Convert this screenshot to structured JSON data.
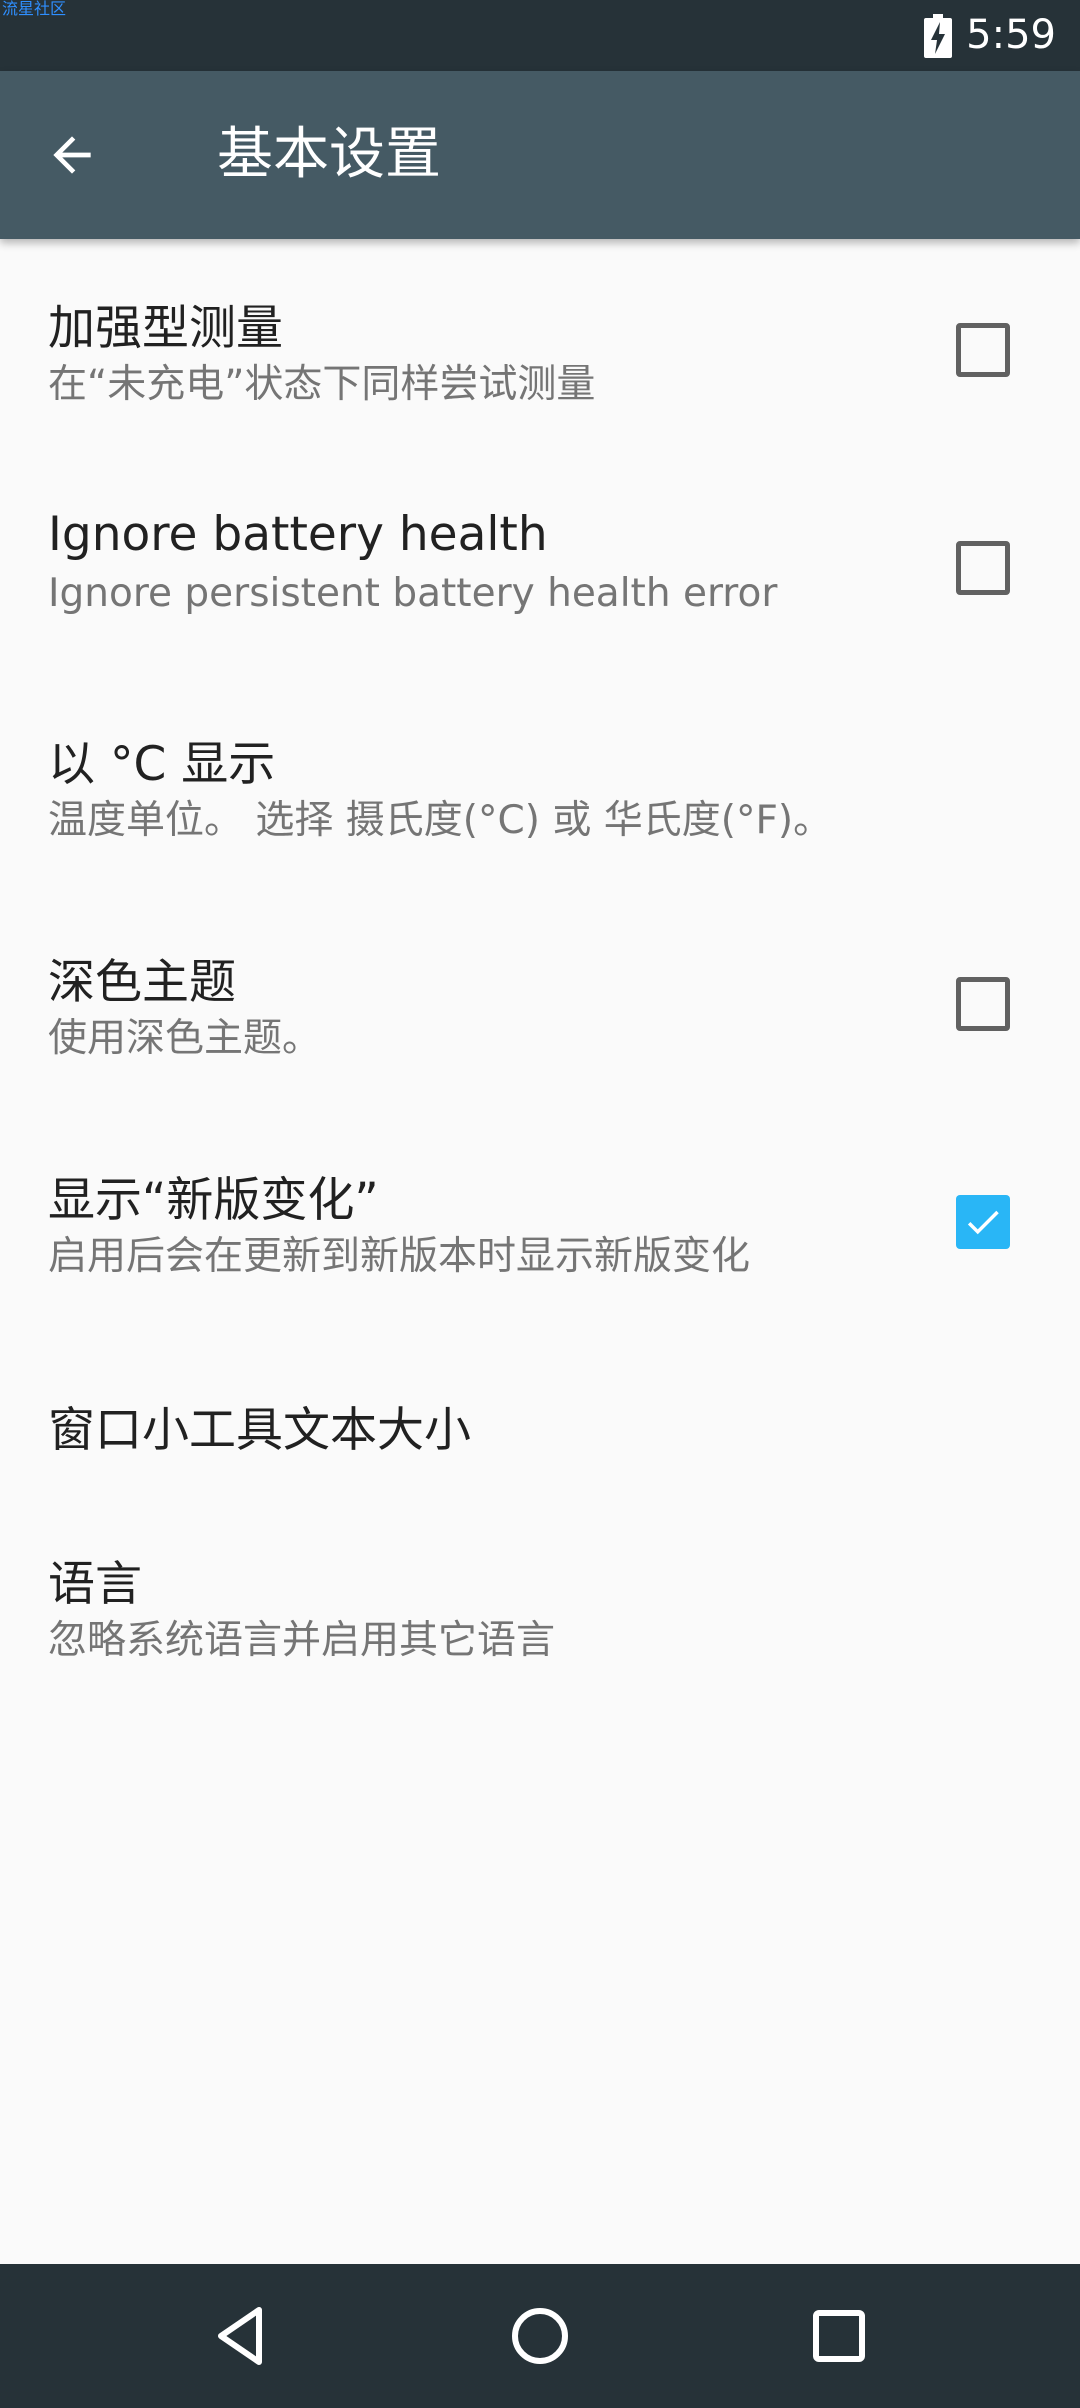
{
  "status_bar": {
    "watermark": "流星社区",
    "time": "5:59",
    "battery_icon": "battery-charging-icon"
  },
  "app_bar": {
    "back_icon": "arrow-left-icon",
    "title": "基本设置"
  },
  "preferences": [
    {
      "title": "加强型测量",
      "summary": "在“未充电”状态下同样尝试测量",
      "has_checkbox": true,
      "checked": false
    },
    {
      "title": "Ignore battery health",
      "summary": "Ignore persistent battery health error",
      "has_checkbox": true,
      "checked": false
    },
    {
      "title": "以 °C 显示",
      "summary": "温度单位。 选择 摄氏度(°C) 或 华氏度(°F)。",
      "has_checkbox": false
    },
    {
      "title": "深色主题",
      "summary": "使用深色主题。",
      "has_checkbox": true,
      "checked": false
    },
    {
      "title": "显示“新版变化”",
      "summary": "启用后会在更新到新版本时显示新版变化",
      "has_checkbox": true,
      "checked": true
    },
    {
      "title": "窗口小工具文本大小",
      "has_checkbox": false
    },
    {
      "title": "语言",
      "summary": "忽略系统语言并启用其它语言",
      "has_checkbox": false
    }
  ],
  "nav_bar": {
    "back_icon": "nav-back-triangle-icon",
    "home_icon": "nav-home-circle-icon",
    "recents_icon": "nav-recents-square-icon"
  },
  "colors": {
    "status_bar": "#263238",
    "app_bar": "#455a64",
    "background": "#fafafa",
    "accent": "#29b6f6",
    "title_text": "#212121",
    "summary_text": "#757575"
  }
}
